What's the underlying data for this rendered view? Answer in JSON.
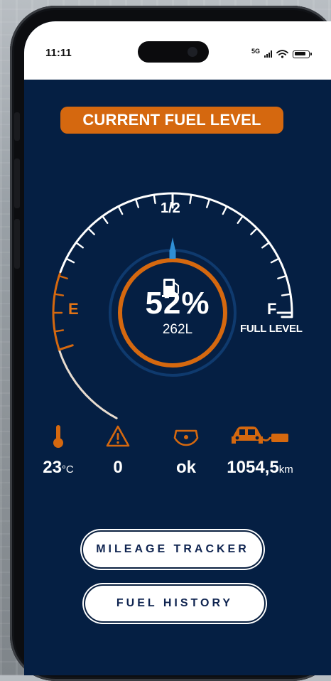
{
  "status_bar": {
    "time": "11:11",
    "network": "5G",
    "icons": [
      "signal-icon",
      "wifi-icon",
      "battery-icon"
    ]
  },
  "header": {
    "title": "CURRENT FUEL LEVEL"
  },
  "gauge": {
    "half_label": "1/2",
    "empty_label": "E",
    "full_label": "F",
    "full_caption": "FULL LEVEL",
    "percent_text": "52%",
    "liters_text": "262L",
    "fuel_fraction": 0.52,
    "icon": "fuel-pump-icon",
    "colors": {
      "accent": "#d5680f",
      "needle": "#2f8fd6",
      "background": "#051f43",
      "ticks": "#ffffff"
    }
  },
  "stats": [
    {
      "icon": "thermometer-icon",
      "value": "23",
      "unit": "°C"
    },
    {
      "icon": "warning-icon",
      "value": "0",
      "unit": ""
    },
    {
      "icon": "engine-check-icon",
      "value": "ok",
      "unit": ""
    },
    {
      "icon": "car-fuel-icon",
      "value": "1054,5",
      "unit": "km"
    }
  ],
  "buttons": {
    "mileage": "MILEAGE TRACKER",
    "history": "FUEL HISTORY"
  }
}
